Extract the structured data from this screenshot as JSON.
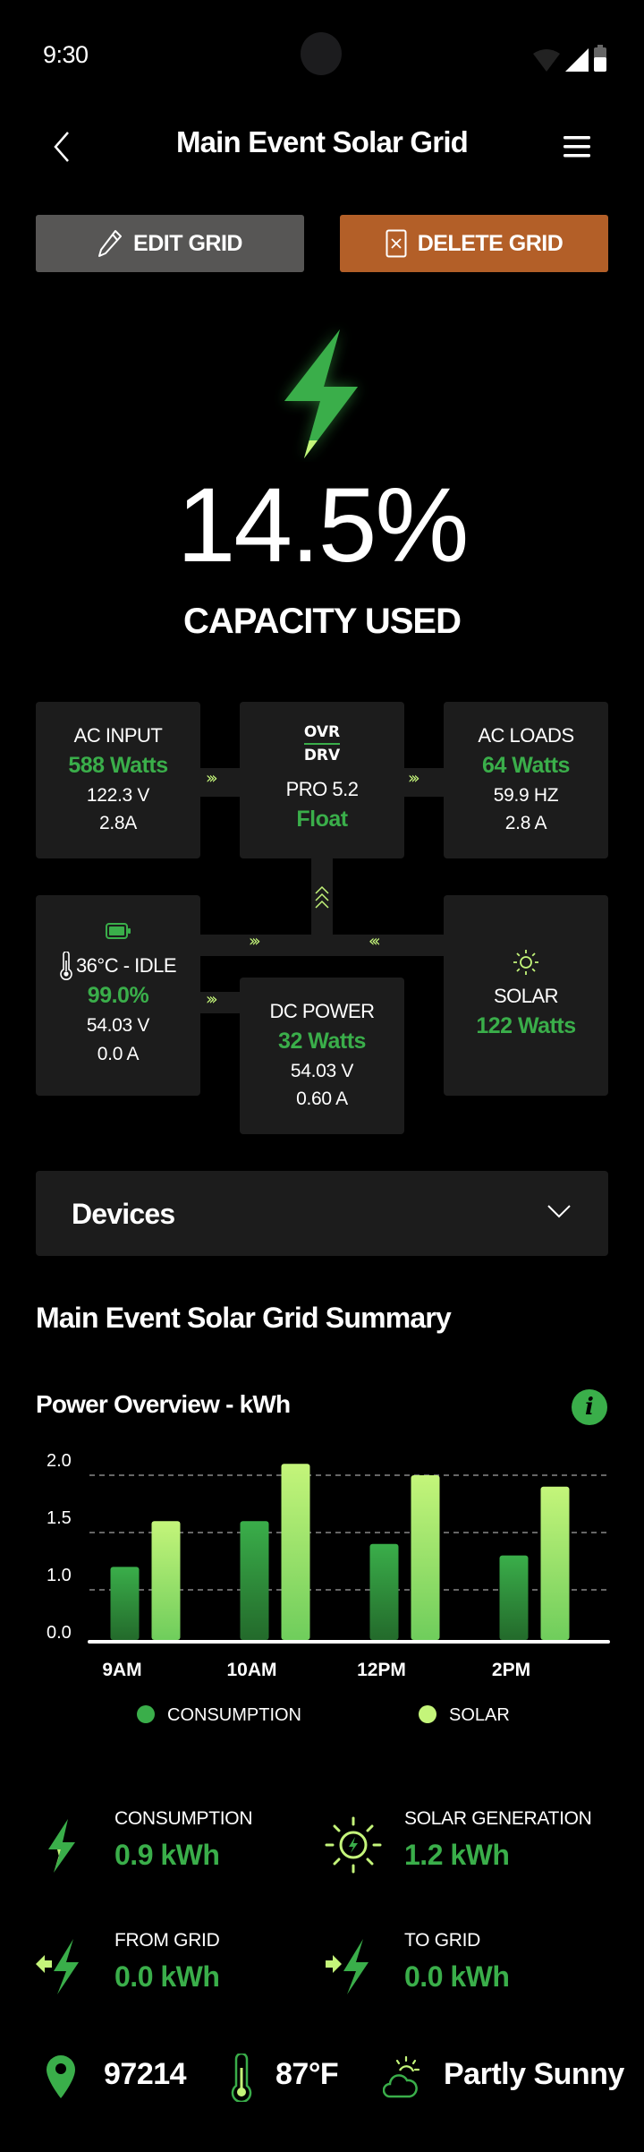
{
  "status_bar": {
    "time": "9:30"
  },
  "header": {
    "title": "Main Event Solar Grid"
  },
  "actions": {
    "edit_label": "EDIT GRID",
    "delete_label": "DELETE GRID"
  },
  "colors": {
    "accent_green": "#3aae4a",
    "light_green": "#c4f57a",
    "delete_orange": "#b35f28",
    "edit_gray": "#575655",
    "panel": "#1c1c1c"
  },
  "hero": {
    "percent": "14.5%",
    "caption": "CAPACITY USED",
    "capacity_used_fraction": 0.145
  },
  "flow": {
    "ac_input": {
      "title": "AC INPUT",
      "power": "588 Watts",
      "voltage": "122.3 V",
      "current": "2.8A"
    },
    "inverter": {
      "brand_top": "OVR",
      "brand_bottom": "DRV",
      "model": "PRO 5.2",
      "mode": "Float"
    },
    "ac_loads": {
      "title": "AC LOADS",
      "power": "64 Watts",
      "frequency": "59.9 HZ",
      "current": "2.8 A"
    },
    "battery": {
      "temp_status": "36°C - IDLE",
      "charge": "99.0%",
      "voltage": "54.03 V",
      "current": "0.0 A"
    },
    "dc_power": {
      "title": "DC POWER",
      "power": "32 Watts",
      "voltage": "54.03 V",
      "current": "0.60 A"
    },
    "solar": {
      "title": "SOLAR",
      "power": "122 Watts"
    },
    "arrow_right": "›››",
    "arrow_left": "‹‹‹"
  },
  "devices": {
    "label": "Devices"
  },
  "summary": {
    "title": "Main Event Solar Grid Summary",
    "chart_title": "Power Overview - kWh"
  },
  "chart_data": {
    "type": "bar",
    "title": "Power Overview - kWh",
    "xlabel": "",
    "ylabel": "kWh",
    "categories": [
      "9AM",
      "10AM",
      "12PM",
      "2PM"
    ],
    "y_ticks": [
      "0.0",
      "1.0",
      "1.5",
      "2.0"
    ],
    "grid": true,
    "legend": "bottom",
    "series": [
      {
        "name": "CONSUMPTION",
        "color": "#3aae4a",
        "values": [
          1.2,
          1.6,
          1.4,
          1.3
        ]
      },
      {
        "name": "SOLAR",
        "color": "#c4f57a",
        "values": [
          1.6,
          2.1,
          2.0,
          1.9
        ]
      }
    ]
  },
  "stats": {
    "consumption": {
      "label": "CONSUMPTION",
      "value": "0.9 kWh"
    },
    "solar_generation": {
      "label": "SOLAR GENERATION",
      "value": "1.2 kWh"
    },
    "from_grid": {
      "label": "FROM GRID",
      "value": "0.0 kWh"
    },
    "to_grid": {
      "label": "TO GRID",
      "value": "0.0 kWh"
    }
  },
  "footer": {
    "zip": "97214",
    "temperature": "87°F",
    "weather": "Partly Sunny"
  }
}
